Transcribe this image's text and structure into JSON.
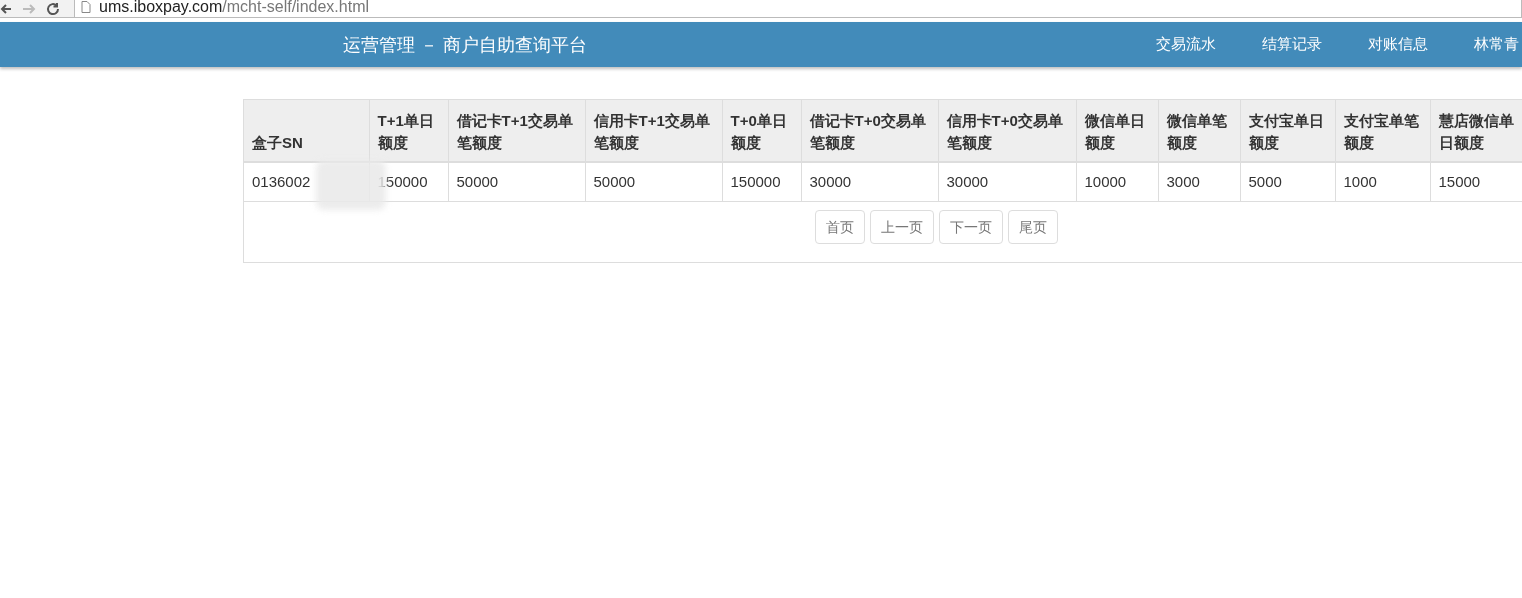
{
  "browser": {
    "url_host": "ums.iboxpay.com",
    "url_path": "/mcht-self/index.html"
  },
  "navbar": {
    "title": "运营管理 － 商户自助查询平台",
    "items": [
      {
        "label": "交易流水"
      },
      {
        "label": "结算记录"
      },
      {
        "label": "对账信息"
      },
      {
        "label": "林常青"
      }
    ]
  },
  "table": {
    "columns": [
      "盒子SN",
      "T+1单日额度",
      "借记卡T+1交易单笔额度",
      "信用卡T+1交易单笔额度",
      "T+0单日额度",
      "借记卡T+0交易单笔额度",
      "信用卡T+0交易单笔额度",
      "微信单日额度",
      "微信单笔额度",
      "支付宝单日额度",
      "支付宝单笔额度",
      "慧店微信单日额度"
    ],
    "rows": [
      [
        "0136002",
        "150000",
        "50000",
        "50000",
        "150000",
        "30000",
        "30000",
        "10000",
        "3000",
        "5000",
        "1000",
        "15000"
      ]
    ]
  },
  "pagination": [
    "首页",
    "上一页",
    "下一页",
    "尾页"
  ]
}
